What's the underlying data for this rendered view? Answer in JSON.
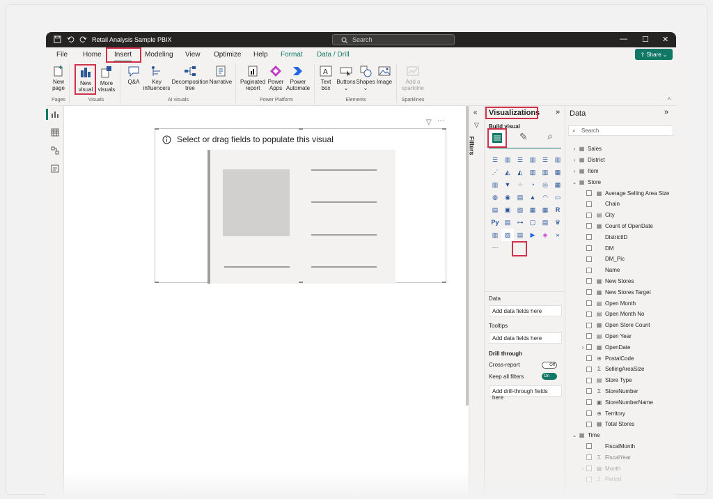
{
  "title": "Retail Analysis Sample PBIX",
  "search": "Search",
  "menu": {
    "file": "File",
    "home": "Home",
    "insert": "Insert",
    "modeling": "Modeling",
    "view": "View",
    "optimize": "Optimize",
    "help": "Help",
    "format": "Format",
    "data_drill": "Data / Drill"
  },
  "share": "Share",
  "ribbon": {
    "new_page_1": "New",
    "new_page_2": "page",
    "pages": "Pages",
    "new_visual_1": "New",
    "new_visual_2": "visual",
    "more_visuals_1": "More",
    "more_visuals_2": "visuals",
    "visuals": "Visuals",
    "qa": "Q&A",
    "key_1": "Key",
    "key_2": "influencers",
    "decomp_1": "Decomposition",
    "decomp_2": "tree",
    "narrative": "Narrative",
    "ai_visuals": "AI visuals",
    "paginated_1": "Paginated",
    "paginated_2": "report",
    "powerapps_1": "Power",
    "powerapps_2": "Apps",
    "automate_1": "Power",
    "automate_2": "Automate",
    "power_platform": "Power Platform",
    "textbox_1": "Text",
    "textbox_2": "box",
    "buttons": "Buttons",
    "shapes": "Shapes",
    "image": "Image",
    "elements": "Elements",
    "sparkline_1": "Add a",
    "sparkline_2": "sparkline",
    "sparklines": "Sparklines"
  },
  "visual_placeholder": "Select or drag fields to populate this visual",
  "filters": "Filters",
  "viz": {
    "title": "Visualizations",
    "build": "Build visual",
    "data": "Data",
    "add_data": "Add data fields here",
    "tooltips": "Tooltips",
    "add_tooltips": "Add data fields here",
    "drill": "Drill through",
    "cross": "Cross-report",
    "off": "Off",
    "keep": "Keep all filters",
    "on": "On",
    "add_drill": "Add drill-through fields here"
  },
  "data": {
    "title": "Data",
    "search": "Search",
    "rows": [
      {
        "t": "table",
        "n": "Sales"
      },
      {
        "t": "table",
        "n": "District"
      },
      {
        "t": "table",
        "n": "Item"
      },
      {
        "t": "open",
        "n": "Store"
      },
      {
        "t": "field",
        "i": "▦",
        "n": "Average Selling Area Size"
      },
      {
        "t": "field",
        "i": "",
        "n": "Chain"
      },
      {
        "t": "field",
        "i": "▤",
        "n": "City"
      },
      {
        "t": "field",
        "i": "▦",
        "n": "Count of OpenDate"
      },
      {
        "t": "field",
        "i": "",
        "n": "DistrictID"
      },
      {
        "t": "field",
        "i": "",
        "n": "DM"
      },
      {
        "t": "field",
        "i": "",
        "n": "DM_Pic"
      },
      {
        "t": "field",
        "i": "",
        "n": "Name"
      },
      {
        "t": "field",
        "i": "▦",
        "n": "New Stores"
      },
      {
        "t": "field",
        "i": "▦",
        "n": "New Stores Target"
      },
      {
        "t": "field",
        "i": "▤",
        "n": "Open Month"
      },
      {
        "t": "field",
        "i": "▤",
        "n": "Open Month No"
      },
      {
        "t": "field",
        "i": "▦",
        "n": "Open Store Count"
      },
      {
        "t": "field",
        "i": "▤",
        "n": "Open Year"
      },
      {
        "t": "fieldx",
        "i": "▦",
        "n": "OpenDate"
      },
      {
        "t": "field",
        "i": "⊕",
        "n": "PostalCode"
      },
      {
        "t": "field",
        "i": "Σ",
        "n": "SellingAreaSize"
      },
      {
        "t": "field",
        "i": "▤",
        "n": "Store Type"
      },
      {
        "t": "field",
        "i": "Σ",
        "n": "StoreNumber"
      },
      {
        "t": "field",
        "i": "▣",
        "n": "StoreNumberName"
      },
      {
        "t": "field",
        "i": "⊕",
        "n": "Territory"
      },
      {
        "t": "field",
        "i": "▦",
        "n": "Total Stores"
      },
      {
        "t": "open",
        "n": "Time"
      },
      {
        "t": "field",
        "i": "",
        "n": "FiscalMonth"
      },
      {
        "t": "field",
        "i": "Σ",
        "n": "FiscalYear"
      },
      {
        "t": "fieldx",
        "i": "▦",
        "n": "Month"
      },
      {
        "t": "field",
        "i": "Σ",
        "n": "Period"
      }
    ]
  }
}
